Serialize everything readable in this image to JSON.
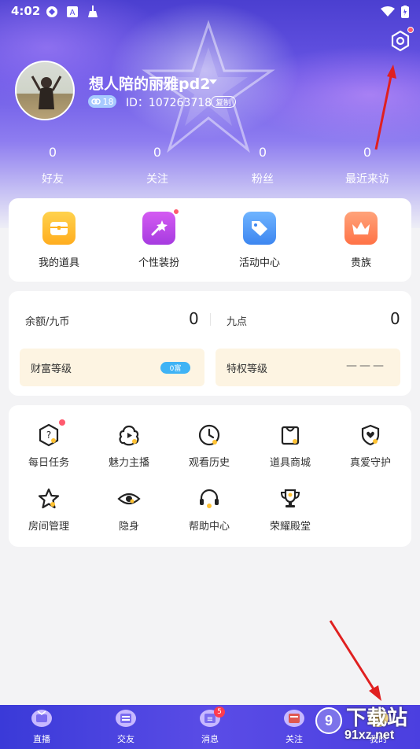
{
  "status_bar": {
    "time": "4:02"
  },
  "profile": {
    "nickname": "想人陪的丽雅pd2",
    "level": "18",
    "id_text": "ID：107263718",
    "copy_label": "复制"
  },
  "stats": [
    {
      "value": "0",
      "label": "好友"
    },
    {
      "value": "0",
      "label": "关注"
    },
    {
      "value": "0",
      "label": "粉丝"
    },
    {
      "value": "0",
      "label": "最近来访"
    }
  ],
  "features": [
    {
      "label": "我的道具",
      "icon": "treasure-chest-icon",
      "color": "#ffc233"
    },
    {
      "label": "个性装扮",
      "icon": "magic-wand-icon",
      "color": "#b54ae8"
    },
    {
      "label": "活动中心",
      "icon": "tag-icon",
      "color": "#4f9cf7"
    },
    {
      "label": "贵族",
      "icon": "crown-icon",
      "color": "#ff8a5c"
    }
  ],
  "balance": {
    "coins_label": "余额/九币",
    "coins_value": "0",
    "points_label": "九点",
    "points_value": "0",
    "wealth_label": "财富等级",
    "wealth_level": "0富",
    "privilege_label": "特权等级",
    "privilege_value": "———"
  },
  "menu": [
    {
      "label": "每日任务",
      "icon": "daily-task-icon"
    },
    {
      "label": "魅力主播",
      "icon": "charm-anchor-icon"
    },
    {
      "label": "观看历史",
      "icon": "clock-icon"
    },
    {
      "label": "道具商城",
      "icon": "shopping-bag-icon"
    },
    {
      "label": "真爱守护",
      "icon": "heart-shield-icon"
    },
    {
      "label": "房间管理",
      "icon": "star-icon"
    },
    {
      "label": "隐身",
      "icon": "eye-icon"
    },
    {
      "label": "帮助中心",
      "icon": "headset-icon"
    },
    {
      "label": "荣耀殿堂",
      "icon": "trophy-icon"
    }
  ],
  "bottom_nav": [
    {
      "label": "直播",
      "icon": "live-icon"
    },
    {
      "label": "交友",
      "icon": "friends-icon"
    },
    {
      "label": "消息",
      "icon": "message-icon",
      "badge": "5"
    },
    {
      "label": "关注",
      "icon": "follow-icon"
    },
    {
      "label": "我的",
      "icon": "mine-icon"
    }
  ],
  "watermark": {
    "line1": "下载站",
    "line2": "91xz.net"
  },
  "colors": {
    "accent": "#4b3fd0",
    "badge_red": "#ff3b4e",
    "arrow_red": "#e02020"
  }
}
